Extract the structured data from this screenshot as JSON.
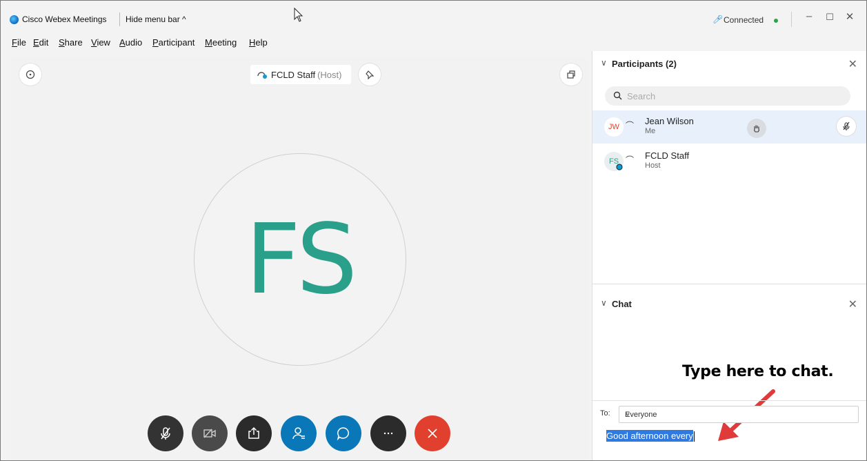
{
  "titlebar": {
    "app_name": "Cisco Webex Meetings",
    "hide_menu": "Hide menu bar ^",
    "status": "Connected",
    "status_color": "#2ba34b"
  },
  "menu": [
    "File",
    "Edit",
    "Share",
    "View",
    "Audio",
    "Participant",
    "Meeting",
    "Help"
  ],
  "menu_mnemonics": [
    "F",
    "E",
    "S",
    "V",
    "A",
    "P",
    "M",
    "H"
  ],
  "stage": {
    "host_name": "FCLD Staff",
    "host_suffix": "(Host)",
    "avatar_initials": "FS",
    "avatar_color": "#2aa08b",
    "controls": [
      {
        "name": "mute-button",
        "icon": "mic-muted-icon",
        "color": "#333333"
      },
      {
        "name": "video-button",
        "icon": "video-off-icon",
        "color": "#4a4a4a"
      },
      {
        "name": "share-button",
        "icon": "share-icon",
        "color": "#2b2b2b"
      },
      {
        "name": "participants-button",
        "icon": "participants-icon",
        "color": "#0a78b8"
      },
      {
        "name": "chat-button",
        "icon": "chat-icon",
        "color": "#0a78b8"
      },
      {
        "name": "more-button",
        "icon": "more-icon",
        "color": "#2b2b2b"
      },
      {
        "name": "leave-button",
        "icon": "close-icon",
        "color": "#e0402d"
      }
    ]
  },
  "participants": {
    "title": "Participants (2)",
    "search_placeholder": "Search",
    "list": [
      {
        "initials": "JW",
        "name": "Jean Wilson",
        "role": "Me",
        "initials_color": "#e0402d"
      },
      {
        "initials": "FS",
        "name": "FCLD Staff",
        "role": "Host",
        "initials_color": "#2aa08b"
      }
    ]
  },
  "chat": {
    "title": "Chat",
    "to_label": "To:",
    "recipient": "Everyone",
    "input_value": "Good afternoon every",
    "annotation": "Type here to chat.",
    "annotation_arrow_color": "#e03a3a"
  }
}
